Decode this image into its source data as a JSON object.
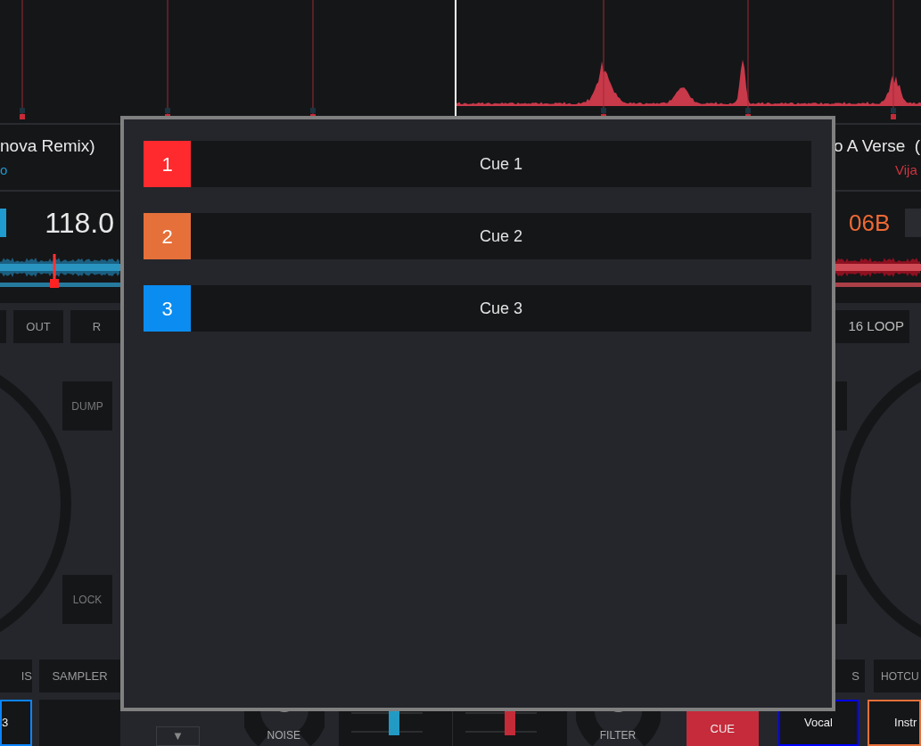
{
  "left_deck": {
    "title": "nova Remix)",
    "artist": "o",
    "bpm": "118.0",
    "buttons": [
      "OUT",
      "R"
    ],
    "jog_buttons": [
      "DUMP",
      "LOCK"
    ],
    "mode_buttons": [
      "IS",
      "SAMPLER"
    ],
    "pads": [
      {
        "label": "3",
        "color": "#0a84ff"
      }
    ]
  },
  "right_deck": {
    "title": "o A Verse  (",
    "artist": "Vija",
    "key": "06B",
    "buttons": [
      "16 LOOP"
    ],
    "mode_buttons": [
      "S",
      "HOTCU"
    ],
    "pads": [
      {
        "label": "Vocal",
        "color": "#0000ff"
      },
      {
        "label": "Instr",
        "color": "#e5703a"
      }
    ]
  },
  "mixer": {
    "toggle": "▼",
    "knobs": [
      "NOISE",
      "FILTER"
    ],
    "faders": [
      {
        "color": "#229ac4"
      },
      {
        "color": "#c42b38"
      }
    ],
    "cue_button": "CUE"
  },
  "cue_dialog": {
    "cues": [
      {
        "number": "1",
        "label": "Cue 1",
        "color": "#ff2a2e"
      },
      {
        "number": "2",
        "label": "Cue 2",
        "color": "#e5703a"
      },
      {
        "number": "3",
        "label": "Cue 3",
        "color": "#0a8cf0"
      }
    ]
  }
}
